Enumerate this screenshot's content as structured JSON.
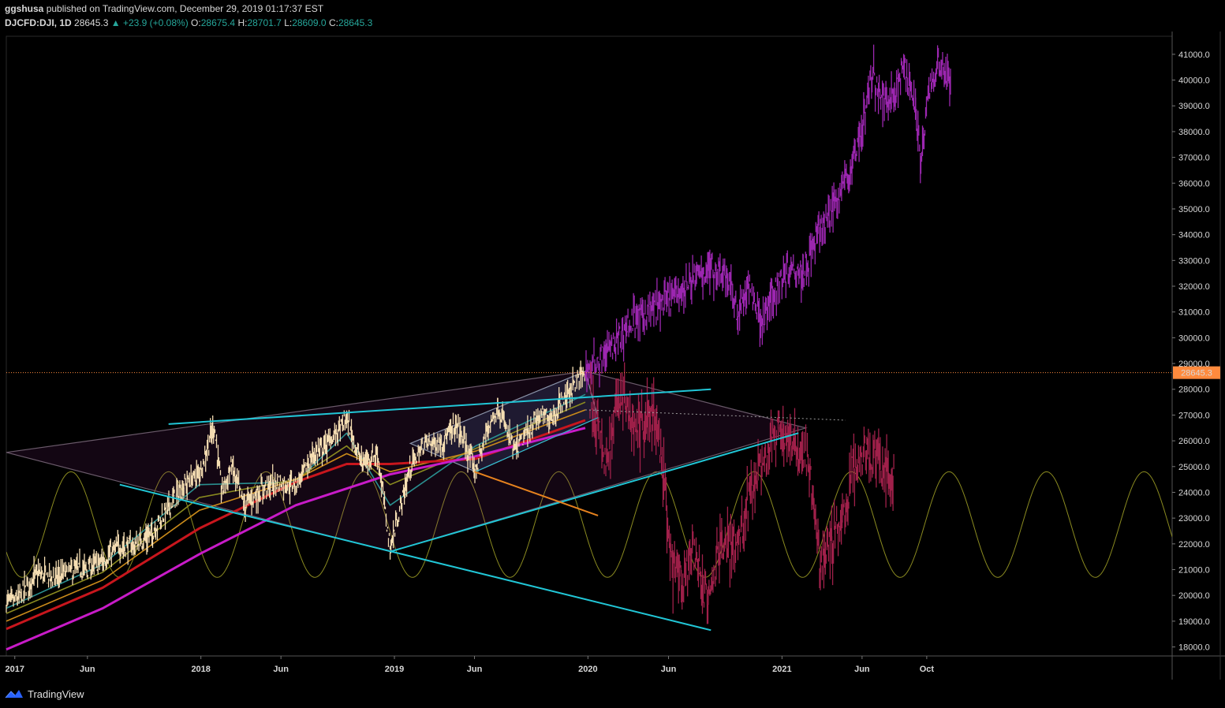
{
  "header": {
    "publisher": "ggshusa",
    "published_text": "published on TradingView.com, December 29, 2019 01:17:37 EST",
    "symbol": "DJCFD:DJI, 1D",
    "last": "28645.3",
    "change": "▲ +23.9 (+0.08%)",
    "o_label": "O:",
    "o_value": "28675.4",
    "h_label": "H:",
    "h_value": "28701.7",
    "l_label": "L:",
    "l_value": "28609.0",
    "c_label": "C:",
    "c_value": "28645.3"
  },
  "footer": {
    "brand": "TradingView"
  },
  "colors": {
    "background": "#000000",
    "price_candles": "#f5deb3",
    "projection_up": "#9c27b0",
    "projection_down": "#a0204a",
    "ma_fast": "#2a8f8f",
    "ma_mid1": "#8a8a20",
    "ma_mid2": "#c98a1a",
    "ma_red": "#c8161d",
    "ma_magenta": "#c81bc8",
    "trendline": "#21c6d6",
    "orange_line": "#e6821e",
    "sine": "#8a8a20",
    "last_price_line": "#ff8a3d",
    "last_price_badge": "#ff8a3d"
  },
  "chart_data": {
    "type": "candlestick",
    "title": "",
    "x_ticks": [
      "2017",
      "Jun",
      "2018",
      "Jun",
      "2019",
      "Jun",
      "2020",
      "Jun",
      "2021",
      "Jun",
      "Oct"
    ],
    "y_ticks": [
      18000,
      19000,
      20000,
      21000,
      22000,
      23000,
      24000,
      25000,
      26000,
      27000,
      28000,
      29000,
      30000,
      31000,
      32000,
      33000,
      34000,
      35000,
      36000,
      37000,
      38000,
      39000,
      40000,
      41000
    ],
    "y_tick_labels": [
      "18000.0",
      "19000.0",
      "20000.0",
      "21000.0",
      "22000.0",
      "23000.0",
      "24000.0",
      "25000.0",
      "26000.0",
      "27000.0",
      "28000.0",
      "29000.0",
      "30000.0",
      "31000.0",
      "32000.0",
      "33000.0",
      "34000.0",
      "35000.0",
      "36000.0",
      "37000.0",
      "38000.0",
      "39000.0",
      "40000.0",
      "41000.0"
    ],
    "ylim": [
      17650,
      41700
    ],
    "last_price": 28645.3,
    "last_price_label": "28645.3",
    "series": [
      {
        "kind": "price",
        "points": [
          [
            "2016-12-30",
            19760
          ],
          [
            "2017-01-20",
            19800
          ],
          [
            "2017-02-24",
            20820
          ],
          [
            "2017-03-31",
            20660
          ],
          [
            "2017-04-28",
            20940
          ],
          [
            "2017-05-31",
            21010
          ],
          [
            "2017-06-30",
            21350
          ],
          [
            "2017-07-31",
            21890
          ],
          [
            "2017-08-31",
            21950
          ],
          [
            "2017-09-29",
            22400
          ],
          [
            "2017-10-31",
            23380
          ],
          [
            "2017-11-30",
            24270
          ],
          [
            "2017-12-29",
            24720
          ],
          [
            "2018-01-26",
            26620
          ],
          [
            "2018-02-09",
            24000
          ],
          [
            "2018-02-28",
            25030
          ],
          [
            "2018-03-23",
            23530
          ],
          [
            "2018-04-30",
            24160
          ],
          [
            "2018-05-31",
            24420
          ],
          [
            "2018-06-29",
            24270
          ],
          [
            "2018-07-31",
            25420
          ],
          [
            "2018-08-31",
            25960
          ],
          [
            "2018-10-03",
            26830
          ],
          [
            "2018-10-31",
            25120
          ],
          [
            "2018-11-30",
            25540
          ],
          [
            "2018-12-24",
            21790
          ],
          [
            "2019-01-31",
            25000
          ],
          [
            "2019-02-28",
            25920
          ],
          [
            "2019-03-29",
            25930
          ],
          [
            "2019-04-30",
            26590
          ],
          [
            "2019-06-03",
            24820
          ],
          [
            "2019-06-28",
            26600
          ],
          [
            "2019-07-15",
            27330
          ],
          [
            "2019-08-15",
            25580
          ],
          [
            "2019-09-30",
            26920
          ],
          [
            "2019-10-31",
            27050
          ],
          [
            "2019-11-29",
            28050
          ],
          [
            "2019-12-27",
            28645
          ]
        ]
      },
      {
        "kind": "projection-up",
        "points": [
          [
            "2019-12-27",
            28645
          ],
          [
            "2020-02-15",
            29600
          ],
          [
            "2020-03-15",
            30500
          ],
          [
            "2020-04-15",
            30900
          ],
          [
            "2020-05-15",
            31300
          ],
          [
            "2020-06-15",
            31700
          ],
          [
            "2020-07-15",
            32200
          ],
          [
            "2020-08-15",
            32700
          ],
          [
            "2020-09-15",
            32600
          ],
          [
            "2020-10-10",
            30900
          ],
          [
            "2020-11-01",
            32000
          ],
          [
            "2020-11-25",
            30600
          ],
          [
            "2020-12-20",
            32000
          ],
          [
            "2021-01-15",
            32800
          ],
          [
            "2021-02-10",
            32600
          ],
          [
            "2021-03-10",
            34000
          ],
          [
            "2021-04-10",
            35200
          ],
          [
            "2021-05-10",
            36500
          ],
          [
            "2021-06-01",
            38200
          ],
          [
            "2021-06-20",
            40200
          ],
          [
            "2021-07-10",
            39200
          ],
          [
            "2021-08-05",
            39600
          ],
          [
            "2021-08-20",
            40600
          ],
          [
            "2021-09-10",
            39000
          ],
          [
            "2021-09-20",
            36700
          ],
          [
            "2021-10-05",
            39600
          ],
          [
            "2021-10-25",
            40700
          ],
          [
            "2021-11-15",
            39900
          ]
        ]
      },
      {
        "kind": "projection-down",
        "points": [
          [
            "2020-01-05",
            27500
          ],
          [
            "2020-02-05",
            25200
          ],
          [
            "2020-03-01",
            27900
          ],
          [
            "2020-04-01",
            26300
          ],
          [
            "2020-05-01",
            27100
          ],
          [
            "2020-05-20",
            25200
          ],
          [
            "2020-06-05",
            21400
          ],
          [
            "2020-06-25",
            20500
          ],
          [
            "2020-07-20",
            21700
          ],
          [
            "2020-08-15",
            19500
          ],
          [
            "2020-09-10",
            22300
          ],
          [
            "2020-10-01",
            21800
          ],
          [
            "2020-10-20",
            22700
          ],
          [
            "2020-11-05",
            24200
          ],
          [
            "2020-12-01",
            25200
          ],
          [
            "2020-12-25",
            26400
          ],
          [
            "2021-01-25",
            25900
          ],
          [
            "2021-02-20",
            25100
          ],
          [
            "2021-03-15",
            21200
          ],
          [
            "2021-04-05",
            22200
          ],
          [
            "2021-04-25",
            22800
          ],
          [
            "2021-05-15",
            25000
          ],
          [
            "2021-06-10",
            25700
          ],
          [
            "2021-07-10",
            25000
          ],
          [
            "2021-08-01",
            24600
          ]
        ]
      }
    ],
    "moving_averages": [
      {
        "name": "fast",
        "color": "#2a8f8f",
        "points": [
          [
            "2016-12-30",
            19500
          ],
          [
            "2017-06-30",
            21200
          ],
          [
            "2017-12-29",
            24300
          ],
          [
            "2018-06-29",
            24400
          ],
          [
            "2018-10-03",
            26300
          ],
          [
            "2018-12-24",
            23500
          ],
          [
            "2019-06-03",
            25800
          ],
          [
            "2019-12-27",
            27800
          ]
        ]
      },
      {
        "name": "mid1",
        "color": "#8a8a20",
        "points": [
          [
            "2016-12-30",
            19300
          ],
          [
            "2017-06-30",
            20900
          ],
          [
            "2017-12-29",
            23800
          ],
          [
            "2018-06-29",
            24500
          ],
          [
            "2018-10-03",
            25800
          ],
          [
            "2018-12-24",
            24300
          ],
          [
            "2019-06-03",
            25700
          ],
          [
            "2019-12-27",
            27500
          ]
        ]
      },
      {
        "name": "mid2",
        "color": "#c98a1a",
        "points": [
          [
            "2016-12-30",
            19000
          ],
          [
            "2017-06-30",
            20600
          ],
          [
            "2017-12-29",
            23300
          ],
          [
            "2018-06-29",
            24500
          ],
          [
            "2018-10-03",
            25500
          ],
          [
            "2018-12-24",
            24800
          ],
          [
            "2019-06-03",
            25600
          ],
          [
            "2019-12-27",
            27200
          ]
        ]
      },
      {
        "name": "red",
        "color": "#c8161d",
        "points": [
          [
            "2016-12-30",
            18700
          ],
          [
            "2017-06-30",
            20300
          ],
          [
            "2017-12-29",
            22600
          ],
          [
            "2018-06-29",
            24400
          ],
          [
            "2018-10-03",
            25100
          ],
          [
            "2018-12-24",
            25100
          ],
          [
            "2019-06-03",
            25300
          ],
          [
            "2019-12-27",
            26800
          ]
        ]
      },
      {
        "name": "magenta",
        "color": "#c81bc8",
        "points": [
          [
            "2016-12-30",
            17900
          ],
          [
            "2017-06-30",
            19500
          ],
          [
            "2017-12-29",
            21600
          ],
          [
            "2018-06-29",
            23500
          ],
          [
            "2018-12-24",
            24700
          ],
          [
            "2019-06-03",
            25400
          ],
          [
            "2019-12-27",
            26500
          ]
        ]
      }
    ],
    "trendlines": [
      {
        "name": "upper-resistance",
        "color": "#21c6d6",
        "from": [
          "2017-11-01",
          26650
        ],
        "to": [
          "2020-08-20",
          28000
        ]
      },
      {
        "name": "lower-support",
        "color": "#21c6d6",
        "from": [
          "2017-08-01",
          24300
        ],
        "to": [
          "2020-08-20",
          18650
        ]
      },
      {
        "name": "rising-support",
        "color": "#21c6d6",
        "from": [
          "2018-12-24",
          21700
        ],
        "to": [
          "2021-02-01",
          26300
        ]
      },
      {
        "name": "channel-lower",
        "color": "#21c6d6",
        "from": [
          "2019-06-03",
          24800
        ],
        "to": [
          "2020-01-20",
          26900
        ]
      },
      {
        "name": "orange-line",
        "color": "#e6821e",
        "from": [
          "2019-06-01",
          24800
        ],
        "to": [
          "2020-01-20",
          23100
        ]
      },
      {
        "name": "dotted-line",
        "color": "#9a9a9a",
        "from": [
          "2019-12-27",
          27200
        ],
        "to": [
          "2021-05-01",
          26800
        ]
      }
    ],
    "patterns": [
      {
        "name": "large-diamond",
        "points": [
          [
            "2016-12-30",
            25550
          ],
          [
            "2019-12-27",
            28700
          ],
          [
            "2021-02-15",
            26500
          ],
          [
            "2018-12-24",
            21700
          ]
        ]
      },
      {
        "name": "inner-channel",
        "points": [
          [
            "2019-01-31",
            25900
          ],
          [
            "2019-12-27",
            28700
          ],
          [
            "2020-01-20",
            26900
          ],
          [
            "2019-06-03",
            24800
          ]
        ]
      }
    ],
    "sine_wave": {
      "color": "#8a8a20",
      "center": 22750,
      "amplitude": 2050,
      "peaks": [
        "2017-05-01",
        "2017-11-01",
        "2018-05-01",
        "2018-11-01",
        "2019-05-01",
        "2019-11-01",
        "2020-05-01",
        "2020-11-01",
        "2021-05-01",
        "2021-11-01",
        "2022-05-01"
      ]
    }
  }
}
